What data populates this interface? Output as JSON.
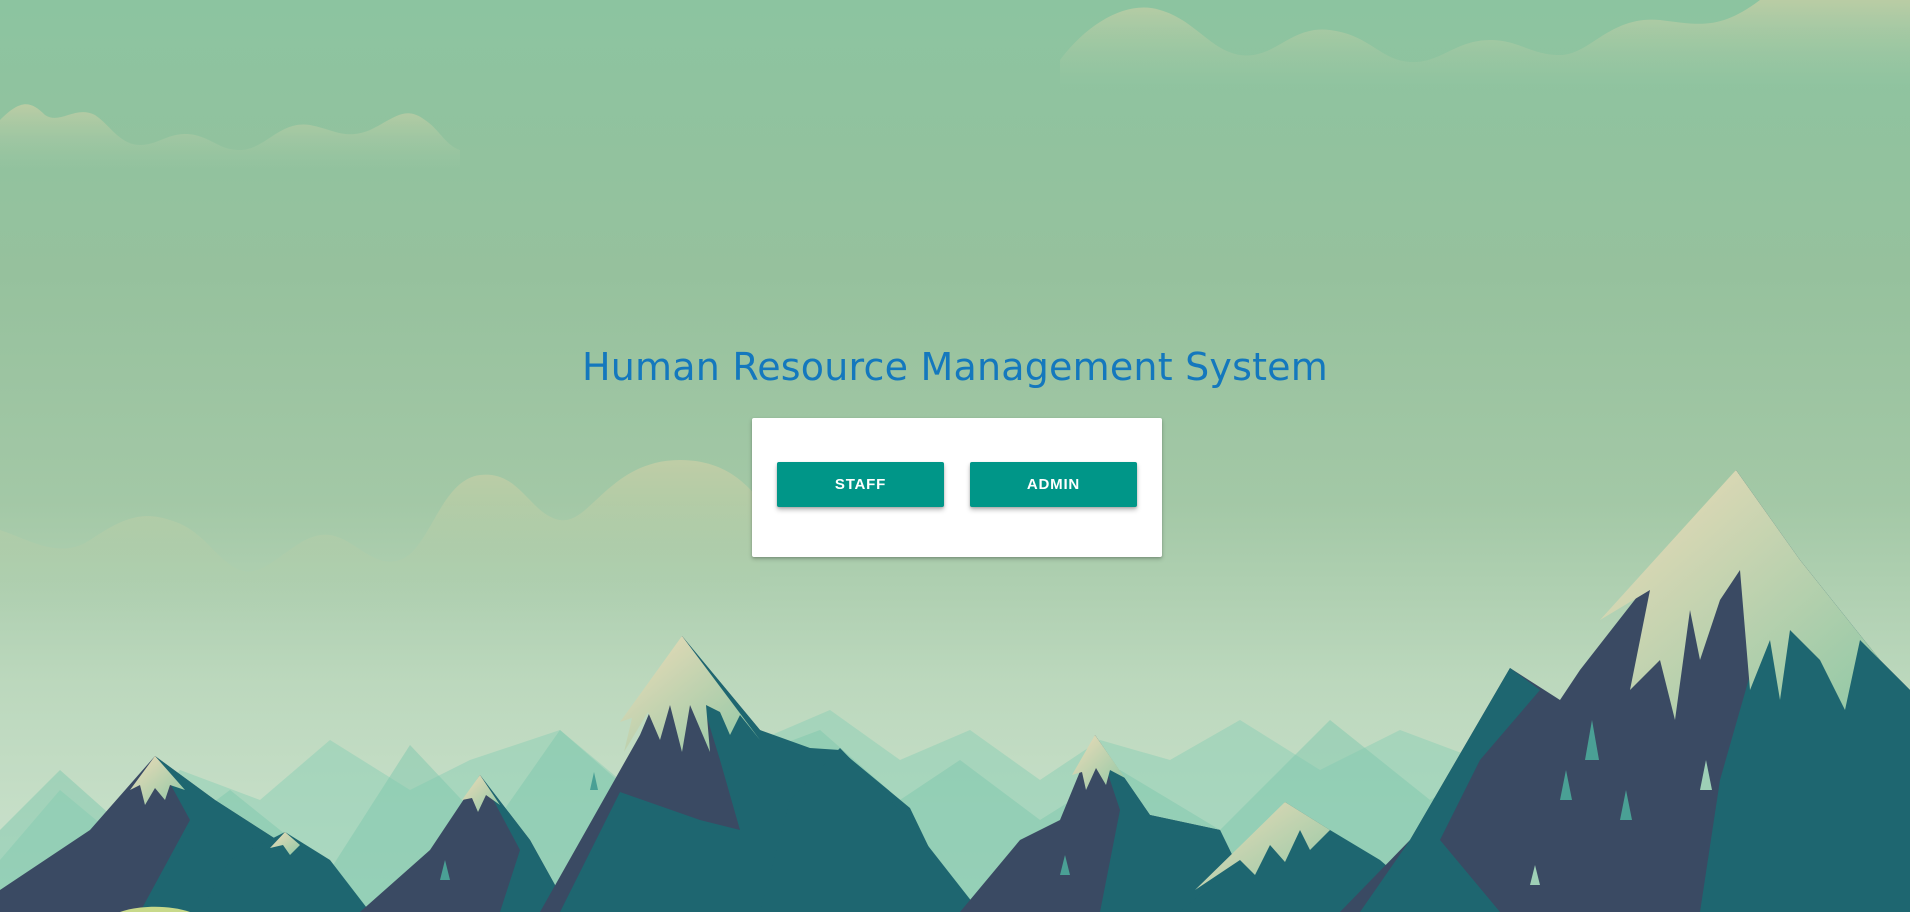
{
  "page": {
    "title": "Human Resource Management System"
  },
  "login_card": {
    "staff_label": "STAFF",
    "admin_label": "ADMIN"
  },
  "colors": {
    "title": "#1478bd",
    "button": "#009688",
    "mountain_dark": "#3a4a63",
    "mountain_teal": "#1e6670",
    "snow": "#e6d7b4"
  }
}
